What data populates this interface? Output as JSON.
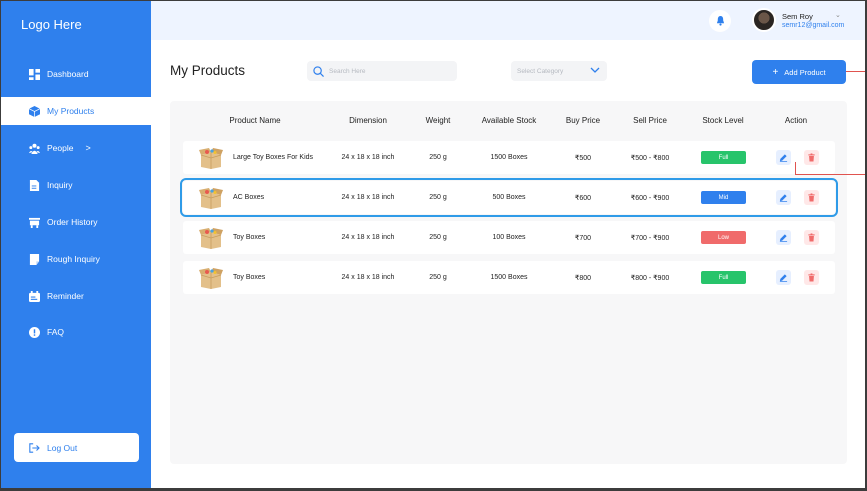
{
  "app": {
    "logo": "Logo Here"
  },
  "sidebar": {
    "items": [
      {
        "label": "Dashboard",
        "icon": "dashboard-grid-icon"
      },
      {
        "label": "My Products",
        "icon": "cube-icon"
      },
      {
        "label": "People",
        "icon": "people-icon",
        "chevron": ">"
      },
      {
        "label": "Inquiry",
        "icon": "inquiry-doc-icon"
      },
      {
        "label": "Order History",
        "icon": "cart-icon"
      },
      {
        "label": "Rough Inquiry",
        "icon": "note-icon"
      },
      {
        "label": "Reminder",
        "icon": "reminder-icon"
      },
      {
        "label": "FAQ",
        "icon": "info-icon"
      }
    ],
    "active_index": 1,
    "logout_label": "Log Out"
  },
  "header": {
    "user_name": "Sem Roy",
    "user_email": "semr12@gmail.com",
    "chevron": "⌄"
  },
  "toolbar": {
    "title": "My Products",
    "search_placeholder": "Search Here",
    "category_placeholder": "Select Category",
    "add_label": "Add Product",
    "add_icon": "+"
  },
  "table": {
    "columns": [
      "Product Name",
      "Dimension",
      "Weight",
      "Available Stock",
      "Buy Price",
      "Sell Price",
      "Stock Level",
      "Action"
    ],
    "rows": [
      {
        "name": "Large Toy Boxes For Kids",
        "dimension": "24 x 18 x 18 inch",
        "weight": "250 g",
        "stock": "1500 Boxes",
        "buy": "₹500",
        "sell": "₹500 - ₹800",
        "level": "Full"
      },
      {
        "name": "AC Boxes",
        "dimension": "24 x 18 x 18 inch",
        "weight": "250 g",
        "stock": "500 Boxes",
        "buy": "₹600",
        "sell": "₹600 - ₹900",
        "level": "Mid"
      },
      {
        "name": "Toy Boxes",
        "dimension": "24 x 18 x 18 inch",
        "weight": "250 g",
        "stock": "100 Boxes",
        "buy": "₹700",
        "sell": "₹700 - ₹900",
        "level": "Low"
      },
      {
        "name": "Toy Boxes",
        "dimension": "24 x 18 x 18 inch",
        "weight": "250 g",
        "stock": "1500 Boxes",
        "buy": "₹800",
        "sell": "₹800 - ₹900",
        "level": "Full"
      }
    ]
  },
  "colors": {
    "primary": "#2f80ed",
    "full": "#27c46b",
    "mid": "#2f80ed",
    "low": "#f06b6b",
    "highlight": "#2f9be8",
    "annotation": "#e0534f"
  }
}
